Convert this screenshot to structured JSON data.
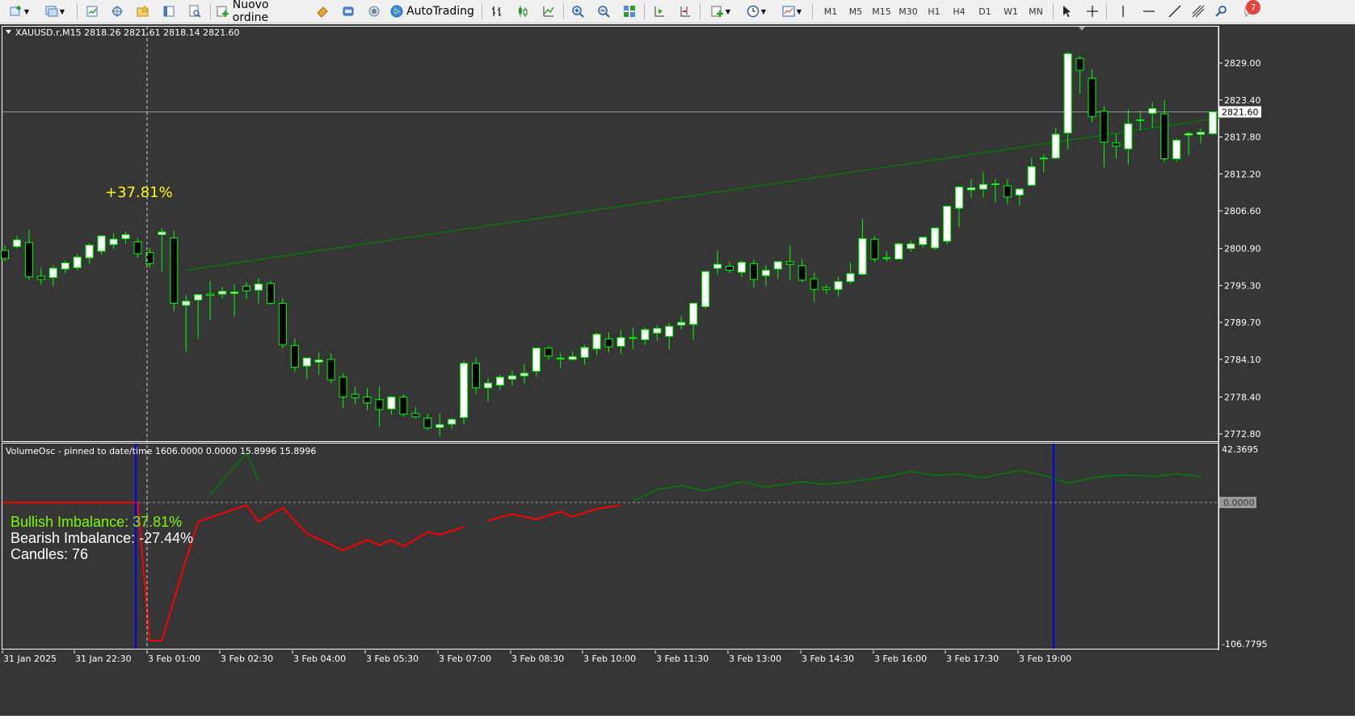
{
  "toolbar": {
    "new_order_label": "Nuovo ordine",
    "autotrading_label": "AutoTrading",
    "timeframes": [
      "M1",
      "M5",
      "M15",
      "M30",
      "H1",
      "H4",
      "D1",
      "W1",
      "MN"
    ],
    "notification_count": "7",
    "icons": [
      "new-chart-icon",
      "profiles-icon",
      "market-watch-icon",
      "navigator-icon",
      "favorites-icon",
      "data-window-icon",
      "strategy-tester-icon",
      "new-order-icon",
      "metaeditor-icon",
      "market-icon",
      "signals-icon",
      "autotrading-icon",
      "bar-chart-icon",
      "candlestick-icon",
      "line-chart-icon",
      "zoom-in-icon",
      "zoom-out-icon",
      "tile-windows-icon",
      "auto-scroll-icon",
      "chart-shift-icon",
      "indicators-icon",
      "periods-icon",
      "templates-icon",
      "cursor-icon",
      "crosshair-icon",
      "vertical-line-icon",
      "horizontal-line-icon",
      "trendline-icon",
      "fibonacci-icon",
      "search-icon",
      "notifications-icon"
    ]
  },
  "main_chart": {
    "header": "XAUUSD.r,M15  2818.26 2821.61 2818.14 2821.60",
    "current_price_label": "2821.60",
    "annotation": "+37.81%",
    "price_labels": [
      "2829.00",
      "2823.40",
      "2817.80",
      "2812.20",
      "2806.60",
      "2800.90",
      "2795.30",
      "2789.70",
      "2784.10",
      "2778.40",
      "2772.80"
    ],
    "colors": {
      "background": "#363636",
      "bull": "#ffffff",
      "bear": "#000000",
      "wick": "#00ff00",
      "trendline": "#008000"
    }
  },
  "oscillator": {
    "header": "VolumeOsc - pinned to date/time 1606.0000 0.0000 15.8996 15.8996",
    "bullish_label": "Bullish Imbalance: 37.81%",
    "bearish_label": "Bearish Imbalance: -27.44%",
    "candles_label": "Candles: 76",
    "max_label": "42.3695",
    "zero_label": "0.0000",
    "min_label": "-106.7795",
    "colors": {
      "bullish_text": "#7cfc00",
      "bullish_line": "#008000",
      "bearish_line": "#ff0000",
      "pin_line": "#0000ff"
    }
  },
  "time_labels": [
    "31 Jan 2025",
    "31 Jan 22:30",
    "3 Feb 01:00",
    "3 Feb 02:30",
    "3 Feb 04:00",
    "3 Feb 05:30",
    "3 Feb 07:00",
    "3 Feb 08:30",
    "3 Feb 10:00",
    "3 Feb 11:30",
    "3 Feb 13:00",
    "3 Feb 14:30",
    "3 Feb 16:00",
    "3 Feb 17:30",
    "3 Feb 19:00"
  ],
  "chart_data": {
    "type": "candlestick",
    "title": "XAUUSD.r,M15",
    "ylim": [
      2770,
      2832
    ],
    "candles": [
      [
        2800.6,
        2801.4,
        2799.0,
        2799.4
      ],
      [
        2801.2,
        2802.8,
        2800.9,
        2802.2
      ],
      [
        2801.8,
        2803.8,
        2796.2,
        2796.6
      ],
      [
        2796.7,
        2798.0,
        2795.4,
        2796.2
      ],
      [
        2796.5,
        2798.3,
        2795.2,
        2797.9
      ],
      [
        2797.8,
        2799.1,
        2797.1,
        2798.7
      ],
      [
        2798.0,
        2800.1,
        2797.6,
        2799.6
      ],
      [
        2799.5,
        2801.7,
        2798.5,
        2801.4
      ],
      [
        2800.5,
        2802.9,
        2800.0,
        2802.8
      ],
      [
        2801.5,
        2803.2,
        2800.8,
        2802.3
      ],
      [
        2802.4,
        2803.5,
        2801.6,
        2803.0
      ],
      [
        2801.9,
        2802.5,
        2799.5,
        2800.1
      ],
      [
        2800.3,
        2801.0,
        2798.0,
        2798.6
      ],
      [
        2803.0,
        2804.0,
        2797.4,
        2803.4
      ],
      [
        2802.5,
        2803.6,
        2791.4,
        2792.6
      ],
      [
        2792.3,
        2793.9,
        2785.2,
        2792.9
      ],
      [
        2793.1,
        2793.6,
        2787.2,
        2793.9
      ],
      [
        2794.0,
        2796.0,
        2790.0,
        2793.8
      ],
      [
        2794.0,
        2795.1,
        2793.3,
        2794.4
      ],
      [
        2794.1,
        2795.5,
        2790.6,
        2794.3
      ],
      [
        2795.2,
        2795.8,
        2793.2,
        2794.5
      ],
      [
        2794.6,
        2796.4,
        2792.6,
        2795.5
      ],
      [
        2795.6,
        2796.0,
        2792.4,
        2792.6
      ],
      [
        2792.6,
        2793.4,
        2785.8,
        2786.3
      ],
      [
        2786.2,
        2787.3,
        2782.2,
        2782.9
      ],
      [
        2783.1,
        2784.2,
        2781.1,
        2784.3
      ],
      [
        2783.7,
        2785.2,
        2781.8,
        2784.0
      ],
      [
        2784.1,
        2785.0,
        2780.5,
        2781.0
      ],
      [
        2781.4,
        2782.0,
        2776.7,
        2778.4
      ],
      [
        2778.8,
        2780.0,
        2777.3,
        2778.3
      ],
      [
        2778.4,
        2779.7,
        2776.4,
        2777.5
      ],
      [
        2778.0,
        2780.0,
        2773.9,
        2776.5
      ],
      [
        2776.6,
        2778.6,
        2775.7,
        2778.4
      ],
      [
        2778.4,
        2778.8,
        2775.4,
        2775.8
      ],
      [
        2775.9,
        2776.9,
        2775.2,
        2775.4
      ],
      [
        2775.2,
        2775.9,
        2773.3,
        2773.7
      ],
      [
        2773.8,
        2776.0,
        2772.4,
        2774.2
      ],
      [
        2774.3,
        2775.2,
        2773.6,
        2775.0
      ],
      [
        2775.3,
        2783.9,
        2774.2,
        2783.5
      ],
      [
        2783.5,
        2784.4,
        2778.8,
        2779.8
      ],
      [
        2779.8,
        2781.3,
        2777.7,
        2780.5
      ],
      [
        2780.2,
        2781.8,
        2779.5,
        2781.4
      ],
      [
        2781.1,
        2782.4,
        2780.1,
        2781.6
      ],
      [
        2781.6,
        2783.4,
        2780.4,
        2782.0
      ],
      [
        2782.3,
        2785.8,
        2781.5,
        2785.8
      ],
      [
        2785.8,
        2786.1,
        2784.1,
        2784.6
      ],
      [
        2784.3,
        2785.1,
        2782.8,
        2784.2
      ],
      [
        2784.1,
        2785.3,
        2783.9,
        2784.5
      ],
      [
        2784.4,
        2786.3,
        2783.3,
        2785.9
      ],
      [
        2785.7,
        2788.1,
        2784.8,
        2787.9
      ],
      [
        2787.2,
        2788.2,
        2785.1,
        2786.0
      ],
      [
        2786.1,
        2788.6,
        2784.9,
        2787.4
      ],
      [
        2787.3,
        2788.9,
        2785.7,
        2787.4
      ],
      [
        2787.1,
        2789.0,
        2786.3,
        2788.6
      ],
      [
        2788.1,
        2789.3,
        2786.9,
        2788.8
      ],
      [
        2787.6,
        2789.6,
        2785.6,
        2789.1
      ],
      [
        2789.3,
        2790.7,
        2788.6,
        2789.7
      ],
      [
        2789.4,
        2792.4,
        2787.1,
        2792.6
      ],
      [
        2792.1,
        2797.0,
        2791.8,
        2797.4
      ],
      [
        2797.9,
        2800.6,
        2797.0,
        2798.5
      ],
      [
        2798.2,
        2798.9,
        2797.1,
        2797.6
      ],
      [
        2797.3,
        2799.1,
        2796.6,
        2798.8
      ],
      [
        2798.6,
        2799.2,
        2795.0,
        2796.2
      ],
      [
        2796.8,
        2798.4,
        2795.2,
        2797.6
      ],
      [
        2797.8,
        2798.7,
        2796.3,
        2798.9
      ],
      [
        2798.9,
        2801.3,
        2796.1,
        2798.5
      ],
      [
        2798.3,
        2799.3,
        2795.8,
        2796.1
      ],
      [
        2796.3,
        2797.2,
        2792.8,
        2794.7
      ],
      [
        2795.0,
        2795.4,
        2794.0,
        2794.7
      ],
      [
        2794.7,
        2796.6,
        2793.6,
        2795.9
      ],
      [
        2795.9,
        2798.8,
        2795.6,
        2797.1
      ],
      [
        2797.0,
        2805.4,
        2796.8,
        2802.4
      ],
      [
        2802.3,
        2802.8,
        2798.8,
        2799.3
      ],
      [
        2799.4,
        2800.5,
        2798.9,
        2799.5
      ],
      [
        2799.3,
        2801.8,
        2799.3,
        2801.6
      ],
      [
        2800.9,
        2802.1,
        2800.4,
        2801.6
      ],
      [
        2801.5,
        2802.6,
        2801.0,
        2802.6
      ],
      [
        2801.0,
        2803.6,
        2800.7,
        2804.0
      ],
      [
        2802.0,
        2807.0,
        2801.5,
        2807.3
      ],
      [
        2807.0,
        2810.4,
        2804.1,
        2810.2
      ],
      [
        2809.8,
        2811.4,
        2808.6,
        2810.1
      ],
      [
        2809.9,
        2812.5,
        2808.6,
        2810.6
      ],
      [
        2810.7,
        2811.4,
        2807.9,
        2810.7
      ],
      [
        2810.4,
        2811.4,
        2807.6,
        2808.7
      ],
      [
        2809.0,
        2809.9,
        2807.4,
        2809.9
      ],
      [
        2810.5,
        2814.6,
        2810.4,
        2813.3
      ],
      [
        2814.6,
        2815.2,
        2812.4,
        2814.6
      ],
      [
        2814.6,
        2819.2,
        2814.4,
        2818.2
      ],
      [
        2818.4,
        2830.7,
        2815.9,
        2830.4
      ],
      [
        2829.7,
        2830.1,
        2824.4,
        2827.9
      ],
      [
        2826.7,
        2828.1,
        2820.0,
        2820.9
      ],
      [
        2821.7,
        2822.5,
        2813.2,
        2817.0
      ],
      [
        2816.9,
        2818.3,
        2814.5,
        2816.4
      ],
      [
        2816.0,
        2822.0,
        2813.6,
        2819.8
      ],
      [
        2820.3,
        2821.8,
        2818.8,
        2820.4
      ],
      [
        2821.4,
        2823.1,
        2819.2,
        2822.1
      ],
      [
        2821.3,
        2823.4,
        2814.0,
        2814.5
      ],
      [
        2814.5,
        2817.6,
        2814.0,
        2817.3
      ],
      [
        2818.1,
        2818.6,
        2815.0,
        2818.3
      ],
      [
        2818.2,
        2819.1,
        2816.8,
        2818.5
      ],
      [
        2818.3,
        2821.6,
        2818.1,
        2821.6
      ]
    ],
    "trendline": {
      "from": [
        15,
        2797.6
      ],
      "to": [
        104,
        2821.6
      ]
    },
    "oscillator_range": [
      -106.7795,
      42.3695
    ],
    "oscillator_red": [
      [
        0,
        0
      ],
      [
        11,
        0
      ],
      [
        12,
        -106.7
      ],
      [
        13,
        -106.7
      ],
      [
        15,
        -44
      ],
      [
        16,
        -15
      ],
      [
        20,
        -2
      ],
      [
        21,
        -15
      ],
      [
        23,
        -4
      ],
      [
        25,
        -24
      ],
      [
        28,
        -37
      ],
      [
        30,
        -29
      ],
      [
        31,
        -33
      ],
      [
        32,
        -29
      ],
      [
        33,
        -34
      ],
      [
        35,
        -23
      ],
      [
        36,
        -25
      ],
      [
        38,
        -19
      ],
      [
        40,
        -14
      ],
      [
        42,
        -9
      ],
      [
        44,
        -13
      ],
      [
        46,
        -7
      ],
      [
        47,
        -11
      ],
      [
        49,
        -5
      ],
      [
        51,
        -2
      ]
    ],
    "oscillator_green": [
      [
        17,
        6
      ],
      [
        20,
        38
      ],
      [
        21,
        17
      ],
      [
        52,
        1
      ],
      [
        54,
        10
      ],
      [
        56,
        13
      ],
      [
        58,
        9
      ],
      [
        61,
        16
      ],
      [
        63,
        12
      ],
      [
        66,
        16
      ],
      [
        68,
        14
      ],
      [
        70,
        16
      ],
      [
        73,
        20
      ],
      [
        75,
        24
      ],
      [
        77,
        21
      ],
      [
        79,
        22
      ],
      [
        81,
        19
      ],
      [
        83,
        23
      ],
      [
        84,
        25
      ],
      [
        86,
        21
      ],
      [
        88,
        15
      ],
      [
        90,
        19
      ],
      [
        92,
        21
      ],
      [
        94,
        21
      ],
      [
        95,
        20
      ],
      [
        97,
        22
      ],
      [
        99,
        20
      ]
    ]
  }
}
